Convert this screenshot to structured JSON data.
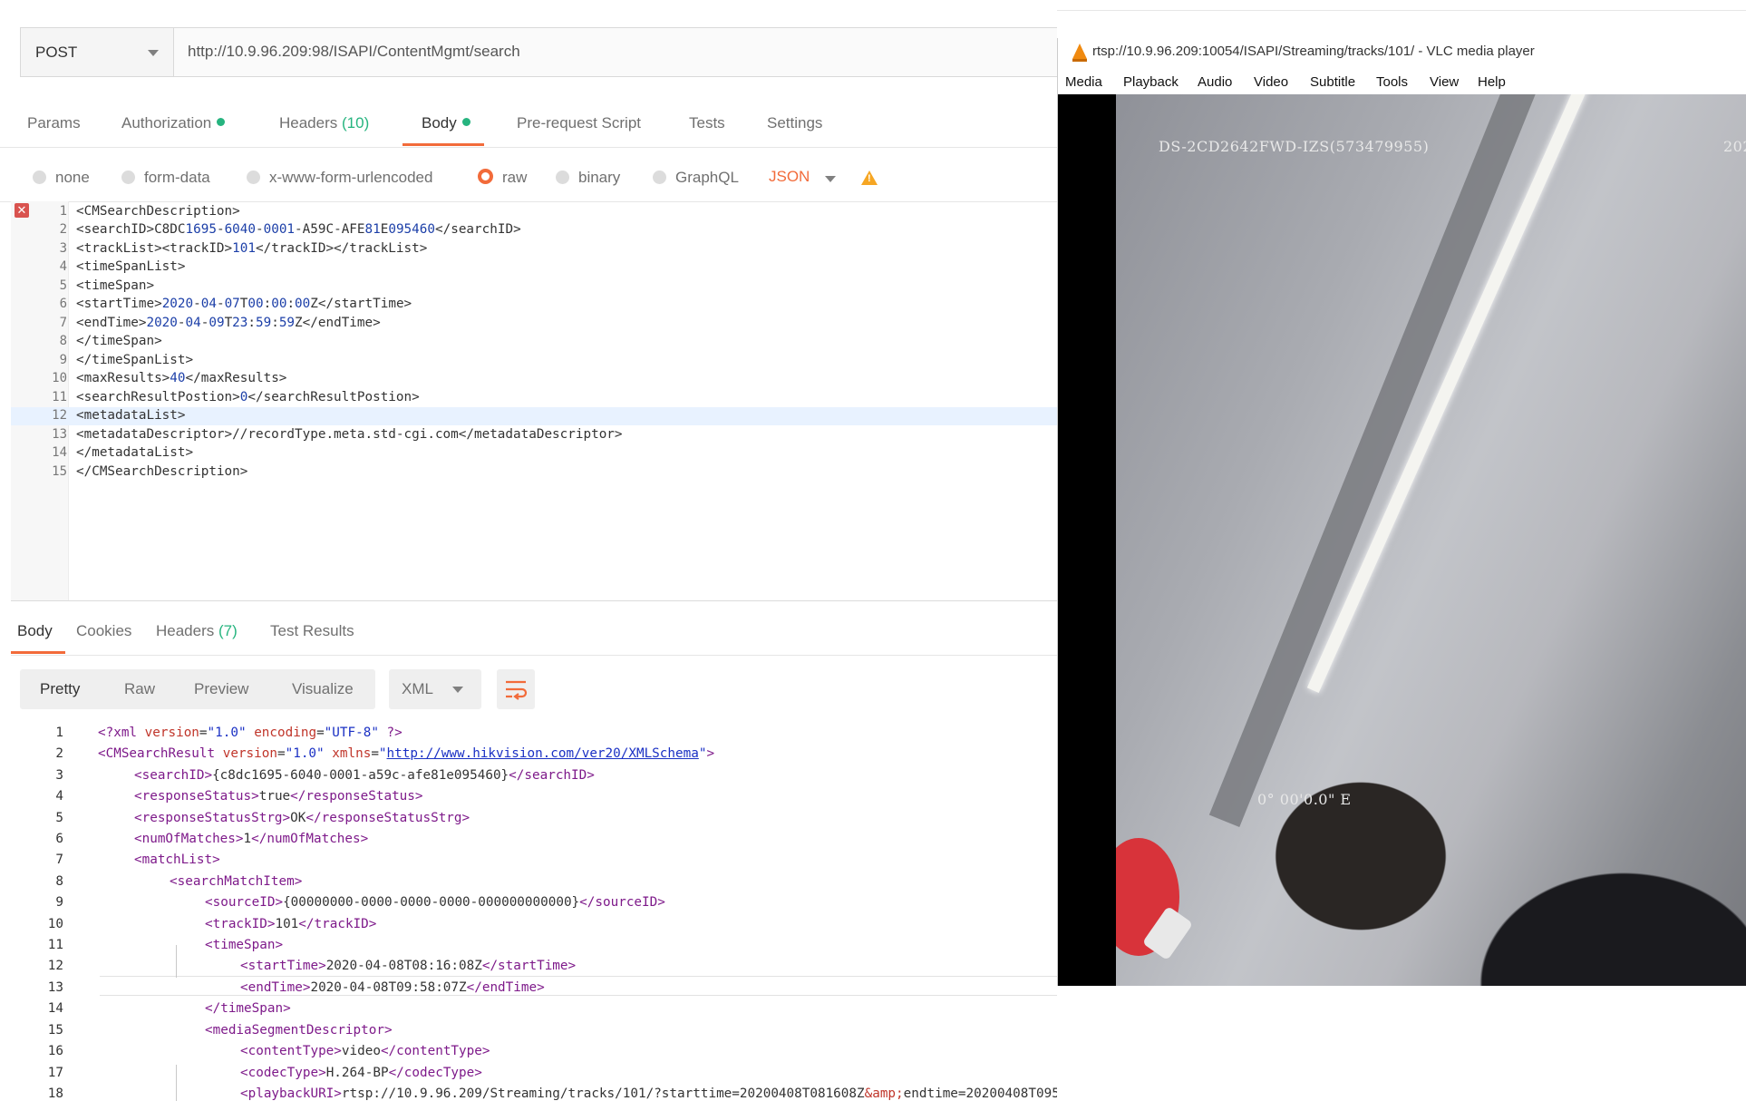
{
  "request": {
    "method": "POST",
    "url": "http://10.9.96.209:98/ISAPI/ContentMgmt/search"
  },
  "request_tabs": {
    "params": "Params",
    "authorization": "Authorization",
    "headers": "Headers",
    "headers_count": "(10)",
    "body": "Body",
    "prerequest": "Pre-request Script",
    "tests": "Tests",
    "settings": "Settings"
  },
  "body_types": {
    "none": "none",
    "form_data": "form-data",
    "urlencoded": "x-www-form-urlencoded",
    "raw": "raw",
    "binary": "binary",
    "graphql": "GraphQL",
    "format": "JSON"
  },
  "request_body_lines": [
    "1",
    "2",
    "3",
    "4",
    "5",
    "6",
    "7",
    "8",
    "9",
    "10",
    "11",
    "12",
    "13",
    "14",
    "15"
  ],
  "response_tabs": {
    "body": "Body",
    "cookies": "Cookies",
    "headers": "Headers",
    "headers_count": "(7)",
    "test_results": "Test Results"
  },
  "view_modes": {
    "pretty": "Pretty",
    "raw": "Raw",
    "preview": "Preview",
    "visualize": "Visualize",
    "format": "XML"
  },
  "vlc": {
    "title": "rtsp://10.9.96.209:10054/ISAPI/Streaming/tracks/101/ - VLC media player",
    "menu": [
      "Media",
      "Playback",
      "Audio",
      "Video",
      "Subtitle",
      "Tools",
      "View",
      "Help"
    ],
    "osd_camera": "DS-2CD2642FWD-IZS(573479955)",
    "osd_date": "202",
    "osd_coord": "0° 00'0.0\" E"
  },
  "colors": {
    "accent": "#f26b3a",
    "success": "#26b47f",
    "warning": "#f6a623"
  }
}
